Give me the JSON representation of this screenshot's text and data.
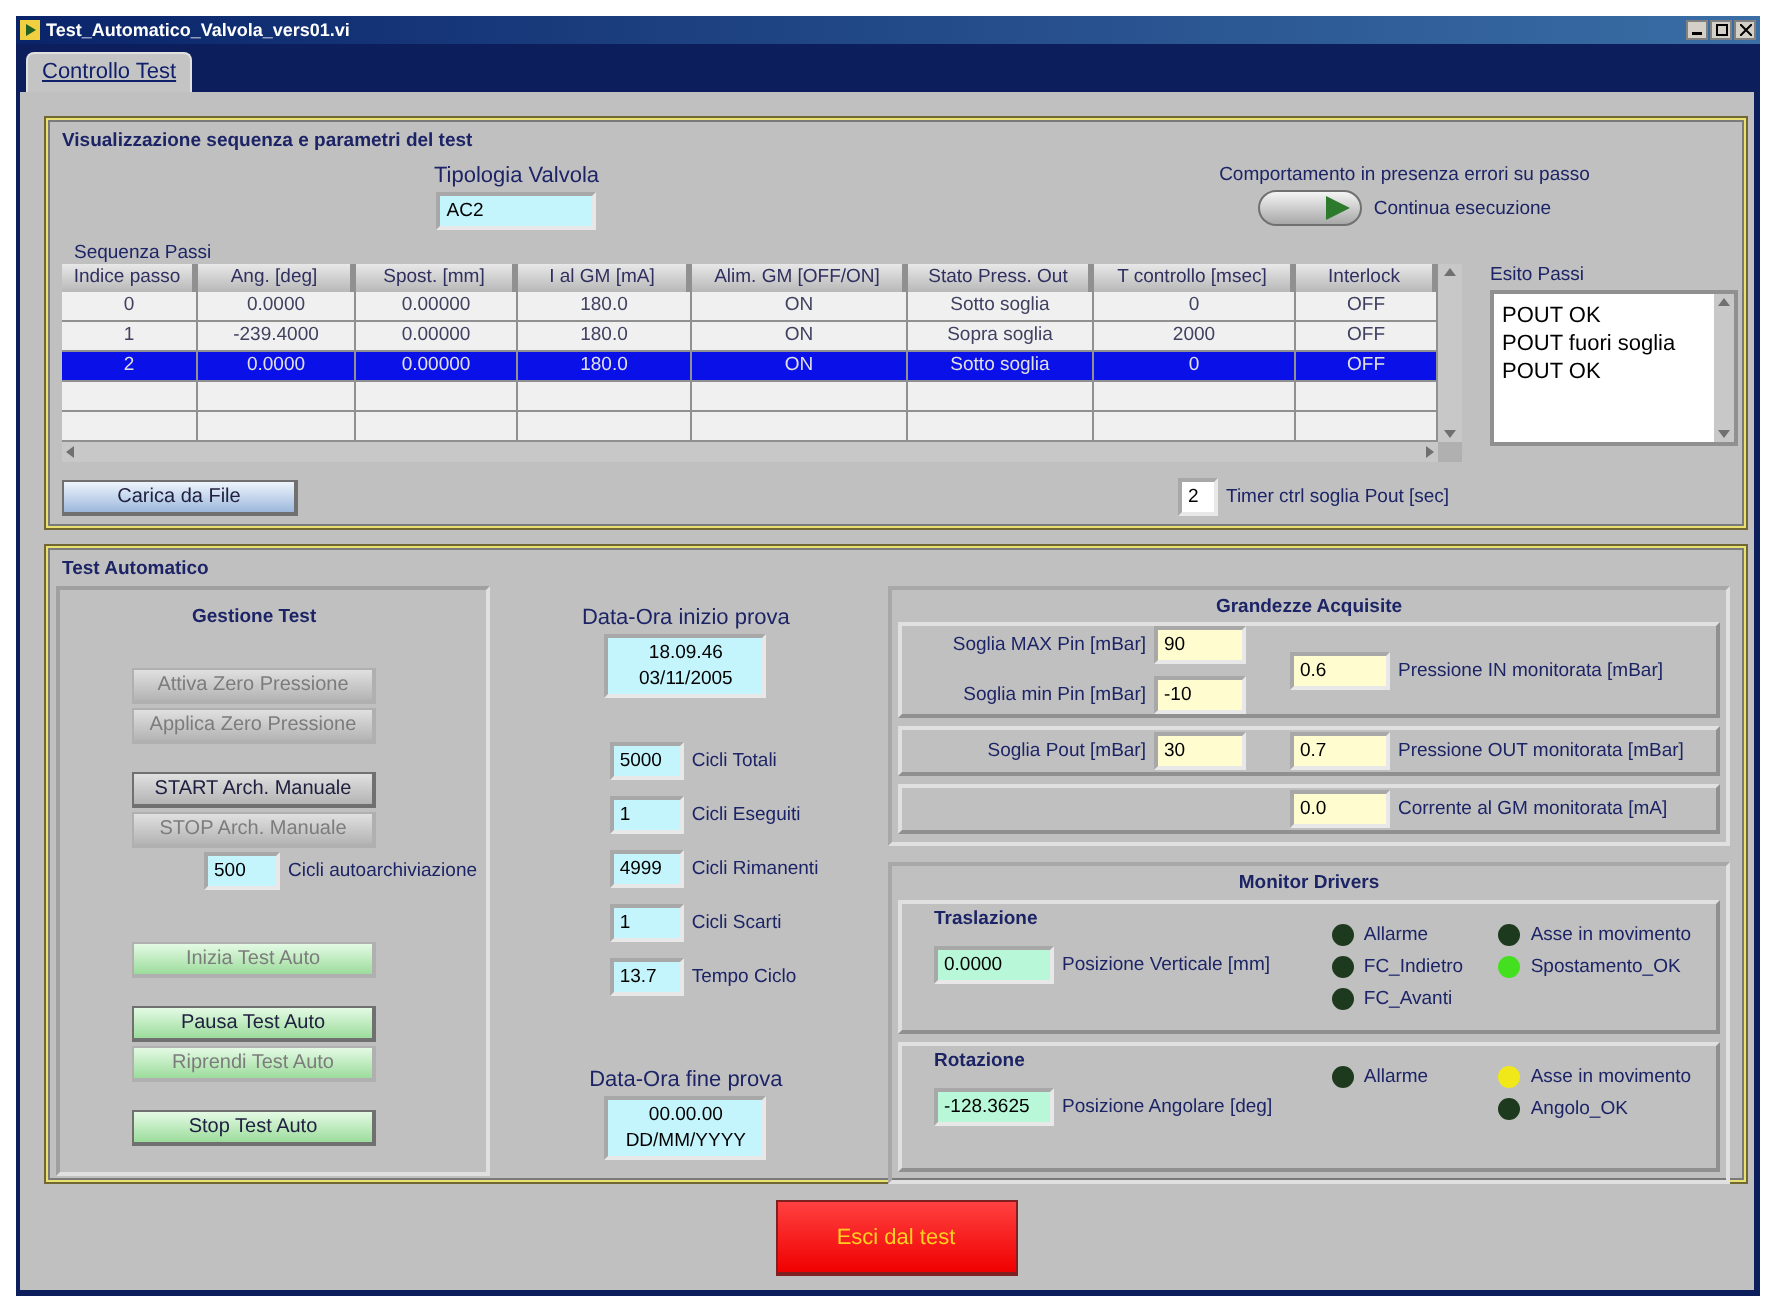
{
  "window": {
    "title": "Test_Automatico_Valvola_vers01.vi"
  },
  "tabs": [
    {
      "label": "Controllo Test",
      "selected": true
    }
  ],
  "sequence_panel": {
    "title": "Visualizzazione sequenza e parametri del test",
    "valve_type": {
      "label": "Tipologia Valvola",
      "value": "AC2"
    },
    "error_behavior": {
      "label": "Comportamento in presenza errori su passo",
      "switch_label": "Continua esecuzione",
      "on": true
    },
    "table": {
      "label": "Sequenza Passi",
      "columns": [
        "Indice passo",
        "Ang. [deg]",
        "Spost. [mm]",
        "I al GM [mA]",
        "Alim. GM [OFF/ON]",
        "Stato Press. Out",
        "T controllo [msec]",
        "Interlock"
      ],
      "rows": [
        {
          "cells": [
            "0",
            "0.0000",
            "0.00000",
            "180.0",
            "ON",
            "Sotto soglia",
            "0",
            "OFF"
          ],
          "selected": false
        },
        {
          "cells": [
            "1",
            "-239.4000",
            "0.00000",
            "180.0",
            "ON",
            "Sopra soglia",
            "2000",
            "OFF"
          ],
          "selected": false
        },
        {
          "cells": [
            "2",
            "0.0000",
            "0.00000",
            "180.0",
            "ON",
            "Sotto soglia",
            "0",
            "OFF"
          ],
          "selected": true
        }
      ]
    },
    "results": {
      "label": "Esito Passi",
      "lines": [
        "POUT OK",
        "POUT fuori soglia",
        "POUT OK"
      ]
    },
    "load_button": "Carica da File",
    "timer": {
      "value": "2",
      "label": "Timer ctrl soglia Pout [sec]"
    }
  },
  "auto_test": {
    "title": "Test Automatico",
    "management": {
      "title": "Gestione Test",
      "groups": [
        [
          {
            "kind": "plain",
            "label": "Attiva Zero Pressione",
            "disabled": true
          },
          {
            "kind": "plain",
            "label": "Applica Zero Pressione",
            "disabled": true
          }
        ],
        [
          {
            "kind": "plain",
            "label": "START Arch. Manuale",
            "disabled": false
          },
          {
            "kind": "plain",
            "label": "STOP   Arch. Manuale",
            "disabled": true
          },
          {
            "kind": "field",
            "value": "500",
            "label": "Cicli autoarchiviazione"
          }
        ],
        [
          {
            "kind": "green",
            "label": "Inizia Test Auto",
            "disabled": true
          }
        ],
        [
          {
            "kind": "green",
            "label": "Pausa Test Auto",
            "disabled": false
          },
          {
            "kind": "green",
            "label": "Riprendi Test Auto",
            "disabled": true
          }
        ],
        [
          {
            "kind": "green",
            "label": "Stop Test Auto",
            "disabled": false
          }
        ]
      ]
    },
    "start": {
      "label": "Data-Ora inizio prova",
      "lines": [
        "18.09.46",
        "03/11/2005"
      ]
    },
    "counters": [
      {
        "value": "5000",
        "label": "Cicli Totali"
      },
      {
        "value": "1",
        "label": "Cicli Eseguiti"
      },
      {
        "value": "4999",
        "label": "Cicli Rimanenti"
      },
      {
        "value": "1",
        "label": "Cicli Scarti"
      },
      {
        "value": "13.7",
        "label": "Tempo Ciclo"
      }
    ],
    "end": {
      "label": "Data-Ora fine prova",
      "lines": [
        "00.00.00",
        "DD/MM/YYYY"
      ]
    },
    "acquired": {
      "title": "Grandezze Acquisite",
      "rows": [
        {
          "thresholds": [
            {
              "label": "Soglia MAX Pin [mBar]",
              "value": "90"
            },
            {
              "label": "Soglia min Pin [mBar]",
              "value": "-10"
            }
          ],
          "monitor": {
            "value": "0.6",
            "label": "Pressione IN monitorata [mBar]"
          }
        },
        {
          "thresholds": [
            {
              "label": "Soglia Pout [mBar]",
              "value": "30"
            }
          ],
          "monitor": {
            "value": "0.7",
            "label": "Pressione OUT monitorata [mBar]"
          }
        },
        {
          "thresholds": [],
          "monitor": {
            "value": "0.0",
            "label": "Corrente al GM monitorata [mA]"
          }
        }
      ]
    },
    "drivers": {
      "title": "Monitor Drivers",
      "sections": [
        {
          "title": "Traslazione",
          "position": {
            "value": "0.0000",
            "label": "Posizione Verticale [mm]"
          },
          "led_columns": [
            [
              {
                "label": "Allarme",
                "color": "#1e3a1e"
              },
              {
                "label": "FC_Indietro",
                "color": "#1e3a1e"
              },
              {
                "label": "FC_Avanti",
                "color": "#1e3a1e"
              }
            ],
            [
              {
                "label": "Asse in movimento",
                "color": "#1e3a1e"
              },
              {
                "label": "Spostamento_OK",
                "color": "#44e020"
              }
            ]
          ]
        },
        {
          "title": "Rotazione",
          "position": {
            "value": "-128.3625",
            "label": "Posizione Angolare [deg]"
          },
          "led_columns": [
            [
              {
                "label": "Allarme",
                "color": "#1e3a1e"
              }
            ],
            [
              {
                "label": "Asse in movimento",
                "color": "#f0e818"
              },
              {
                "label": "Angolo_OK",
                "color": "#1e3a1e"
              }
            ]
          ]
        }
      ]
    }
  },
  "exit_button": "Esci dal test"
}
